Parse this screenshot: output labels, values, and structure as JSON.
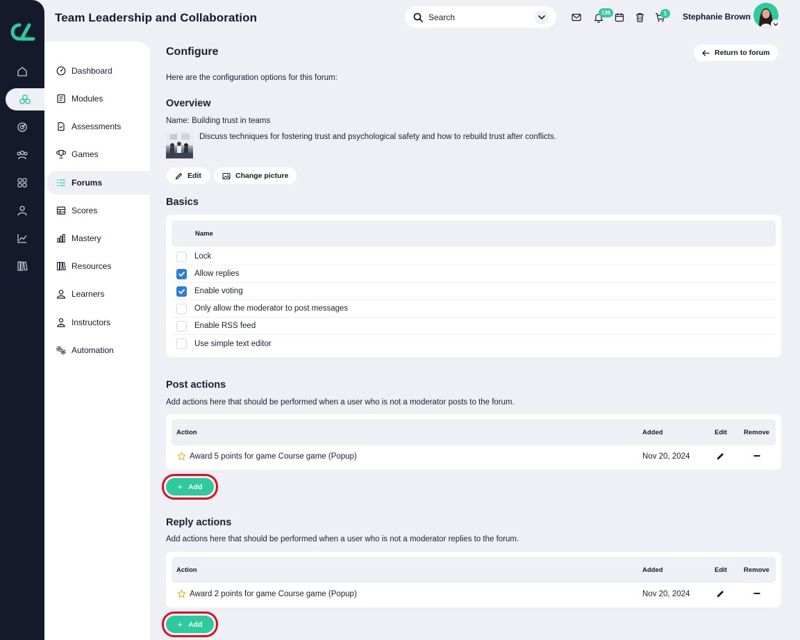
{
  "header": {
    "title": "Team Leadership and Collaboration",
    "search_placeholder": "Search",
    "notifications_count": "196",
    "cart_count": "1",
    "user_name": "Stephanie Brown"
  },
  "rail": {
    "icons": [
      "home-icon",
      "modules-icon",
      "target-icon",
      "users-icon",
      "apps-icon",
      "profile-icon",
      "analytics-icon",
      "library-icon"
    ]
  },
  "subnav": {
    "items": [
      {
        "label": "Dashboard",
        "icon": "dashboard-icon"
      },
      {
        "label": "Modules",
        "icon": "book-icon"
      },
      {
        "label": "Assessments",
        "icon": "document-icon"
      },
      {
        "label": "Games",
        "icon": "trophy-icon"
      },
      {
        "label": "Forums",
        "icon": "list-icon",
        "active": true
      },
      {
        "label": "Scores",
        "icon": "table-icon"
      },
      {
        "label": "Mastery",
        "icon": "bars-icon"
      },
      {
        "label": "Resources",
        "icon": "library-icon"
      },
      {
        "label": "Learners",
        "icon": "person-icon"
      },
      {
        "label": "Instructors",
        "icon": "instructor-icon"
      },
      {
        "label": "Automation",
        "icon": "gears-icon"
      }
    ]
  },
  "main": {
    "heading": "Configure",
    "return_label": "Return to forum",
    "intro": "Here are the configuration options for this forum:",
    "overview": {
      "heading": "Overview",
      "name_line": "Name: Building trust in teams",
      "description": "Discuss techniques for fostering trust and psychological safety and how to rebuild trust after conflicts.",
      "edit_label": "Edit",
      "change_picture_label": "Change picture"
    },
    "basics": {
      "heading": "Basics",
      "column_header": "Name",
      "options": [
        {
          "label": "Lock",
          "checked": false
        },
        {
          "label": "Allow replies",
          "checked": true
        },
        {
          "label": "Enable voting",
          "checked": true
        },
        {
          "label": "Only allow the moderator to post messages",
          "checked": false
        },
        {
          "label": "Enable RSS feed",
          "checked": false
        },
        {
          "label": "Use simple text editor",
          "checked": false
        }
      ]
    },
    "post_actions": {
      "heading": "Post actions",
      "description": "Add actions here that should be performed when a user who is not a moderator posts to the forum.",
      "columns": [
        "Action",
        "Added",
        "Edit",
        "Remove"
      ],
      "rows": [
        {
          "action": "Award 5 points for game Course game (Popup)",
          "added": "Nov 20, 2024"
        }
      ],
      "add_label": "Add"
    },
    "reply_actions": {
      "heading": "Reply actions",
      "description": "Add actions here that should be performed when a user who is not a moderator replies to the forum.",
      "columns": [
        "Action",
        "Added",
        "Edit",
        "Remove"
      ],
      "rows": [
        {
          "action": "Award 2 points for game Course game (Popup)",
          "added": "Nov 20, 2024"
        }
      ],
      "add_label": "Add"
    }
  },
  "colors": {
    "accent": "#2ec99c",
    "rail": "#141a2b",
    "checkbox": "#2b7fd8",
    "highlight": "#e10c1e",
    "star": "#f0b429"
  }
}
